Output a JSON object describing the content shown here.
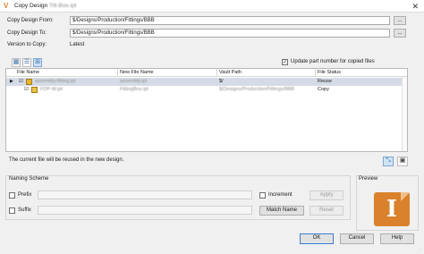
{
  "window": {
    "title_prefix": "Copy Design",
    "title_name": "Tilt-Box.ipt",
    "close_glyph": "✕",
    "app_icon_glyph": "V"
  },
  "form": {
    "copy_from_label": "Copy Design From:",
    "copy_from_value": "$/Designs/Production/Fittings/BBB",
    "copy_to_label": "Copy Design To:",
    "copy_to_value": "$/Designs/Production/Fittings/BBB",
    "version_label": "Version to Copy:",
    "version_value": "Latest",
    "browse_label": "..."
  },
  "toolbar": {
    "update_part_number_label": "Update part number for copied files",
    "update_part_number_checked": true
  },
  "grid": {
    "columns": [
      "File Name",
      "New File Name",
      "Vault Path",
      "File Status"
    ],
    "rows": [
      {
        "file_name": "assembly-fitting.ipt",
        "new_file_name": "assembly.ipt",
        "vault_path": "$/",
        "status": "Reuse"
      },
      {
        "file_name": "FDP-W.ipt",
        "new_file_name": "FittingBox.ipt",
        "vault_path": "$/Designs/Production/Fittings/BBB",
        "status": "Copy"
      }
    ]
  },
  "status_message": "The current file will be reused in the new design.",
  "naming": {
    "title": "Naming Scheme",
    "prefix_label": "Prefix",
    "suffix_label": "Suffix",
    "increment_label": "Increment",
    "apply_label": "Apply",
    "match_name_label": "Match Name",
    "reset_label": "Reset"
  },
  "preview": {
    "title": "Preview",
    "logo_letter": "I"
  },
  "footer": {
    "ok_label": "OK",
    "cancel_label": "Cancel",
    "help_label": "Help"
  }
}
